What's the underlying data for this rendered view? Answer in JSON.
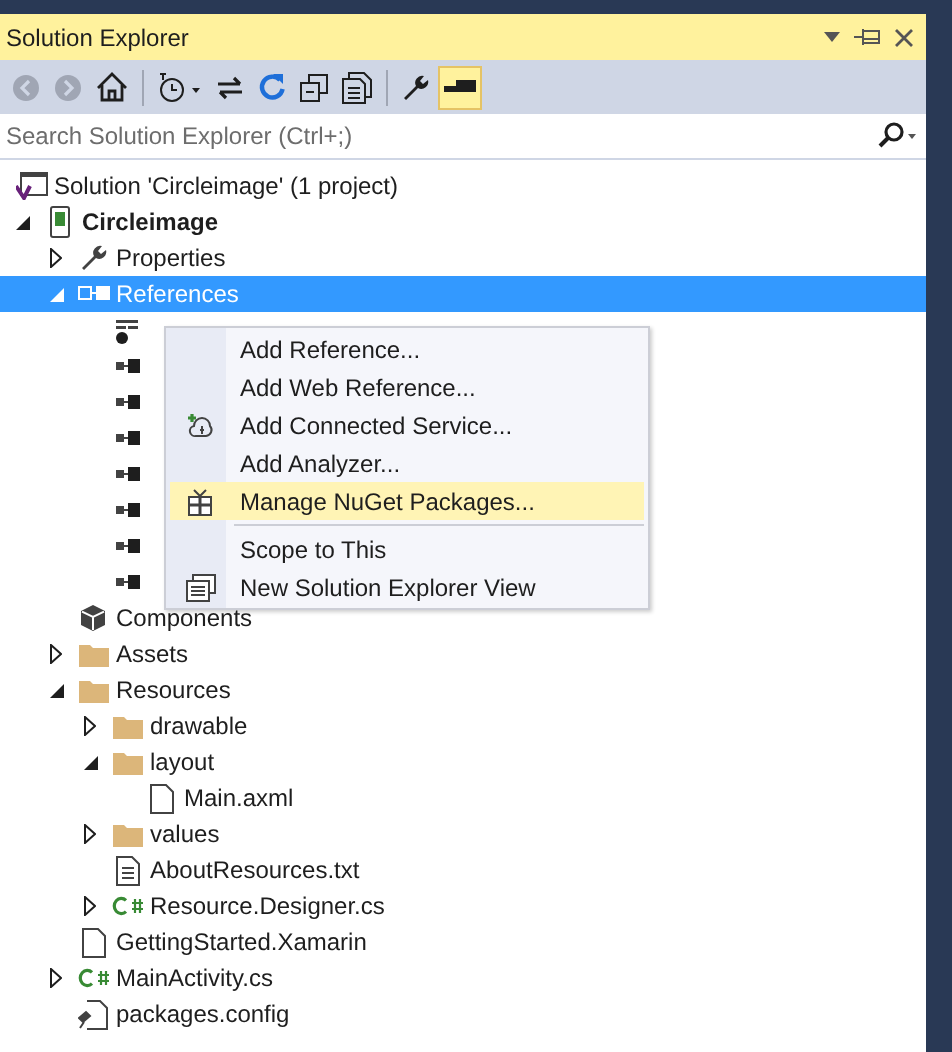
{
  "window": {
    "title": "Solution Explorer"
  },
  "toolbar": [
    {
      "kind": "back",
      "disabled": true,
      "selected": false
    },
    {
      "kind": "forward",
      "disabled": true,
      "selected": false
    },
    {
      "kind": "home",
      "disabled": false,
      "selected": false
    },
    {
      "kind": "history",
      "disabled": false,
      "selected": false
    },
    {
      "kind": "sync",
      "disabled": false,
      "selected": false
    },
    {
      "kind": "refresh",
      "disabled": false,
      "selected": false
    },
    {
      "kind": "collapse",
      "disabled": false,
      "selected": false
    },
    {
      "kind": "show-files",
      "disabled": false,
      "selected": false
    },
    {
      "kind": "properties",
      "disabled": false,
      "selected": false
    },
    {
      "kind": "preview",
      "disabled": false,
      "selected": true
    }
  ],
  "search": {
    "placeholder": "Search Solution Explorer (Ctrl+;)"
  },
  "solution": {
    "label": "Solution 'Circleimage' (1 project)",
    "selected": false
  },
  "tree": [
    {
      "label": "Circleimage",
      "kind": "project",
      "bold": true,
      "expanded": true,
      "selected": false,
      "children": [
        {
          "label": "Properties",
          "kind": "wrench",
          "expanded": false,
          "selected": false
        },
        {
          "label": "References",
          "kind": "references",
          "expanded": true,
          "selected": true,
          "children": [
            {
              "kind": "analyzer",
              "selected": false
            },
            {
              "kind": "reference",
              "selected": false
            },
            {
              "kind": "reference",
              "selected": false
            },
            {
              "kind": "reference",
              "selected": false
            },
            {
              "kind": "reference",
              "selected": false
            },
            {
              "kind": "reference",
              "selected": false
            },
            {
              "kind": "reference",
              "selected": false
            },
            {
              "kind": "reference",
              "selected": false
            }
          ]
        },
        {
          "label": "Components",
          "kind": "component",
          "selected": false
        },
        {
          "label": "Assets",
          "kind": "folder",
          "expanded": false,
          "selected": false
        },
        {
          "label": "Resources",
          "kind": "folder",
          "expanded": true,
          "selected": false,
          "children": [
            {
              "label": "drawable",
              "kind": "folder",
              "expanded": false,
              "selected": false
            },
            {
              "label": "layout",
              "kind": "folder",
              "expanded": true,
              "selected": false,
              "children": [
                {
                  "label": "Main.axml",
                  "kind": "file",
                  "selected": false
                }
              ]
            },
            {
              "label": "values",
              "kind": "folder",
              "expanded": false,
              "selected": false
            },
            {
              "label": "AboutResources.txt",
              "kind": "text",
              "selected": false
            },
            {
              "label": "Resource.Designer.cs",
              "kind": "csharp",
              "expanded": false,
              "selected": false
            }
          ]
        },
        {
          "label": "GettingStarted.Xamarin",
          "kind": "file",
          "selected": false
        },
        {
          "label": "MainActivity.cs",
          "kind": "csharp",
          "expanded": false,
          "selected": false
        },
        {
          "label": "packages.config",
          "kind": "config",
          "selected": false
        }
      ]
    }
  ],
  "context_menu": {
    "groups": [
      [
        {
          "label": "Add Reference...",
          "kind": "plain",
          "selected": false
        },
        {
          "label": "Add Web Reference...",
          "kind": "plain",
          "selected": false
        },
        {
          "label": "Add Connected Service...",
          "kind": "service",
          "selected": false
        },
        {
          "label": "Add Analyzer...",
          "kind": "plain",
          "selected": false
        },
        {
          "label": "Manage NuGet Packages...",
          "kind": "package",
          "selected": true
        }
      ],
      [
        {
          "label": "Scope to This",
          "kind": "plain",
          "selected": false
        },
        {
          "label": "New Solution Explorer View",
          "kind": "view",
          "selected": false
        }
      ]
    ]
  }
}
